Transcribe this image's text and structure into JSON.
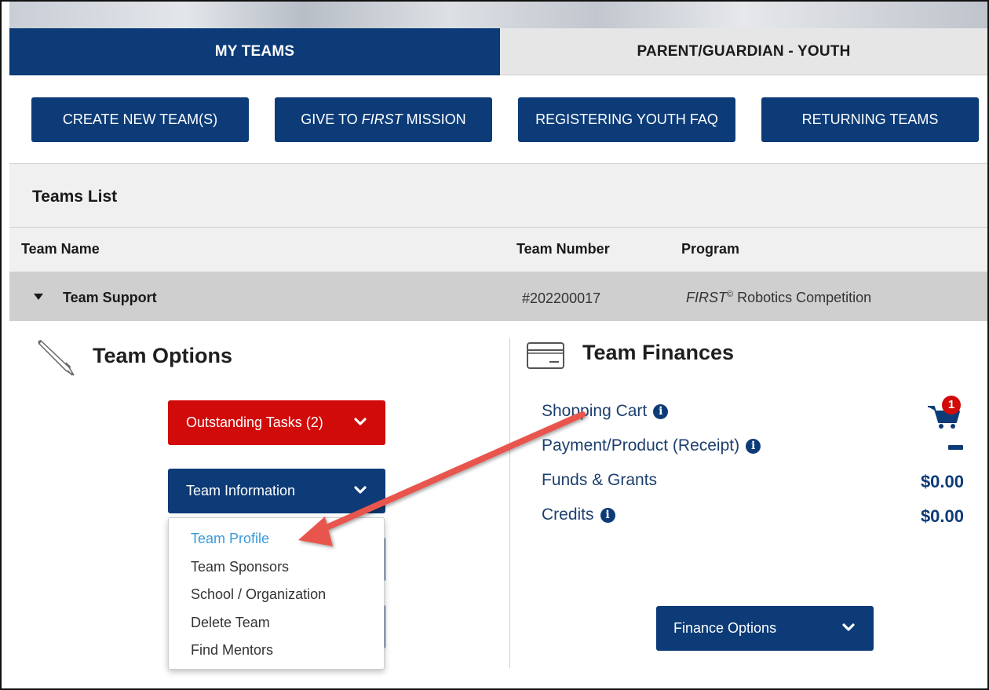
{
  "tabs": {
    "active": "MY TEAMS",
    "inactive": "PARENT/GUARDIAN - YOUTH"
  },
  "actions": {
    "create": "CREATE NEW TEAM(S)",
    "give_prefix": "GIVE TO",
    "give_first": "FIRST",
    "give_suffix": "MISSION",
    "faq": "REGISTERING YOUTH FAQ",
    "returning": "RETURNING TEAMS"
  },
  "teams_list": {
    "title": "Teams List",
    "columns": {
      "name": "Team Name",
      "number": "Team Number",
      "program": "Program"
    },
    "row": {
      "name": "Team Support",
      "number": "#202200017",
      "program_first": "FIRST",
      "program_mark": "©",
      "program_rest": " Robotics Competition"
    }
  },
  "team_options": {
    "title": "Team Options",
    "outstanding": "Outstanding Tasks (2)",
    "team_info": "Team Information",
    "menu": [
      "Team Profile",
      "Team Sponsors",
      "School / Organization",
      "Delete Team",
      "Find Mentors"
    ]
  },
  "team_finances": {
    "title": "Team Finances",
    "shopping_cart": "Shopping Cart",
    "cart_badge": "1",
    "payment": "Payment/Product (Receipt)",
    "funds": "Funds & Grants",
    "funds_value": "$0.00",
    "credits": "Credits",
    "credits_value": "$0.00",
    "finance_options": "Finance Options"
  },
  "colors": {
    "navy": "#0c3b77",
    "red": "#d10a0a",
    "link": "#3a9ad9",
    "annotation_arrow": "#e8554e"
  }
}
